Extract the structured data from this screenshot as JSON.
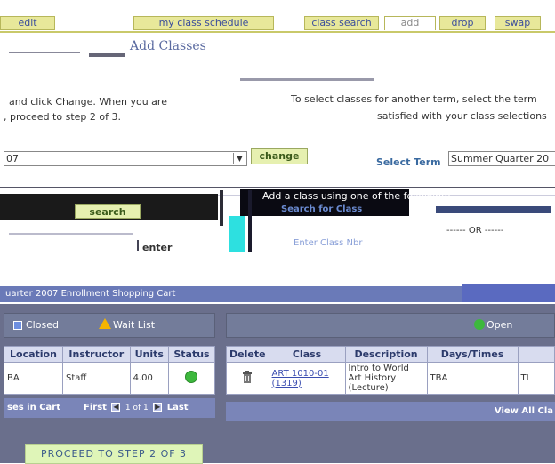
{
  "tabs": [
    {
      "label": "edit",
      "active": false
    },
    {
      "label": "my class schedule",
      "active": false
    },
    {
      "label": "class search",
      "active": false
    },
    {
      "label": "add",
      "active": true
    },
    {
      "label": "drop",
      "active": false
    },
    {
      "label": "swap",
      "active": false
    }
  ],
  "page": {
    "title": "Add Classes",
    "instructions_left_1": "and click Change. When you are",
    "instructions_left_2": ", proceed to step 2 of 3.",
    "instructions_right_1": "To select classes for another term, select the term",
    "instructions_right_2": "satisfied with your class selections"
  },
  "term_controls": {
    "left_select_value": "07",
    "change_label": "change",
    "select_term_label": "Select Term",
    "term_value": "Summer Quarter 20"
  },
  "add_section": {
    "add_a_class_text": "Add a class using one of the following:",
    "search_label": "search",
    "search_for_class_label": "Search for Class",
    "enter_label": "enter",
    "enter_class_nbr_label": "Enter Class Nbr",
    "or_label": "------ OR ------"
  },
  "banner_text": "uarter 2007 Enrollment Shopping Cart",
  "legend": {
    "closed": "Closed",
    "wait_list": "Wait List",
    "open": "Open"
  },
  "left_table": {
    "headers": [
      "Location",
      "Instructor",
      "Units",
      "Status"
    ],
    "rows": [
      {
        "location": "BA",
        "instructor": "Staff",
        "units": "4.00",
        "status": "open"
      }
    ],
    "footer_left": "ses in Cart",
    "first_label": "First",
    "paging": "1 of 1",
    "last_label": "Last"
  },
  "right_table": {
    "headers": [
      "Delete",
      "Class",
      "Description",
      "Days/Times",
      ""
    ],
    "rows": [
      {
        "class_link": "ART 1010-01 (1319)",
        "description": "Intro to World Art History (Lecture)",
        "days_times": "TBA",
        "room": "TI"
      }
    ],
    "footer_right": "View All Cla"
  },
  "proceed_label": "PROCEED TO STEP 2 OF 3",
  "colors": {
    "tab_bg": "#e8e89a",
    "accent_blue": "#3a4d9c",
    "panel_gray": "#6a6f8c",
    "status_open": "#3db83d",
    "wait_list": "#f4b400"
  }
}
